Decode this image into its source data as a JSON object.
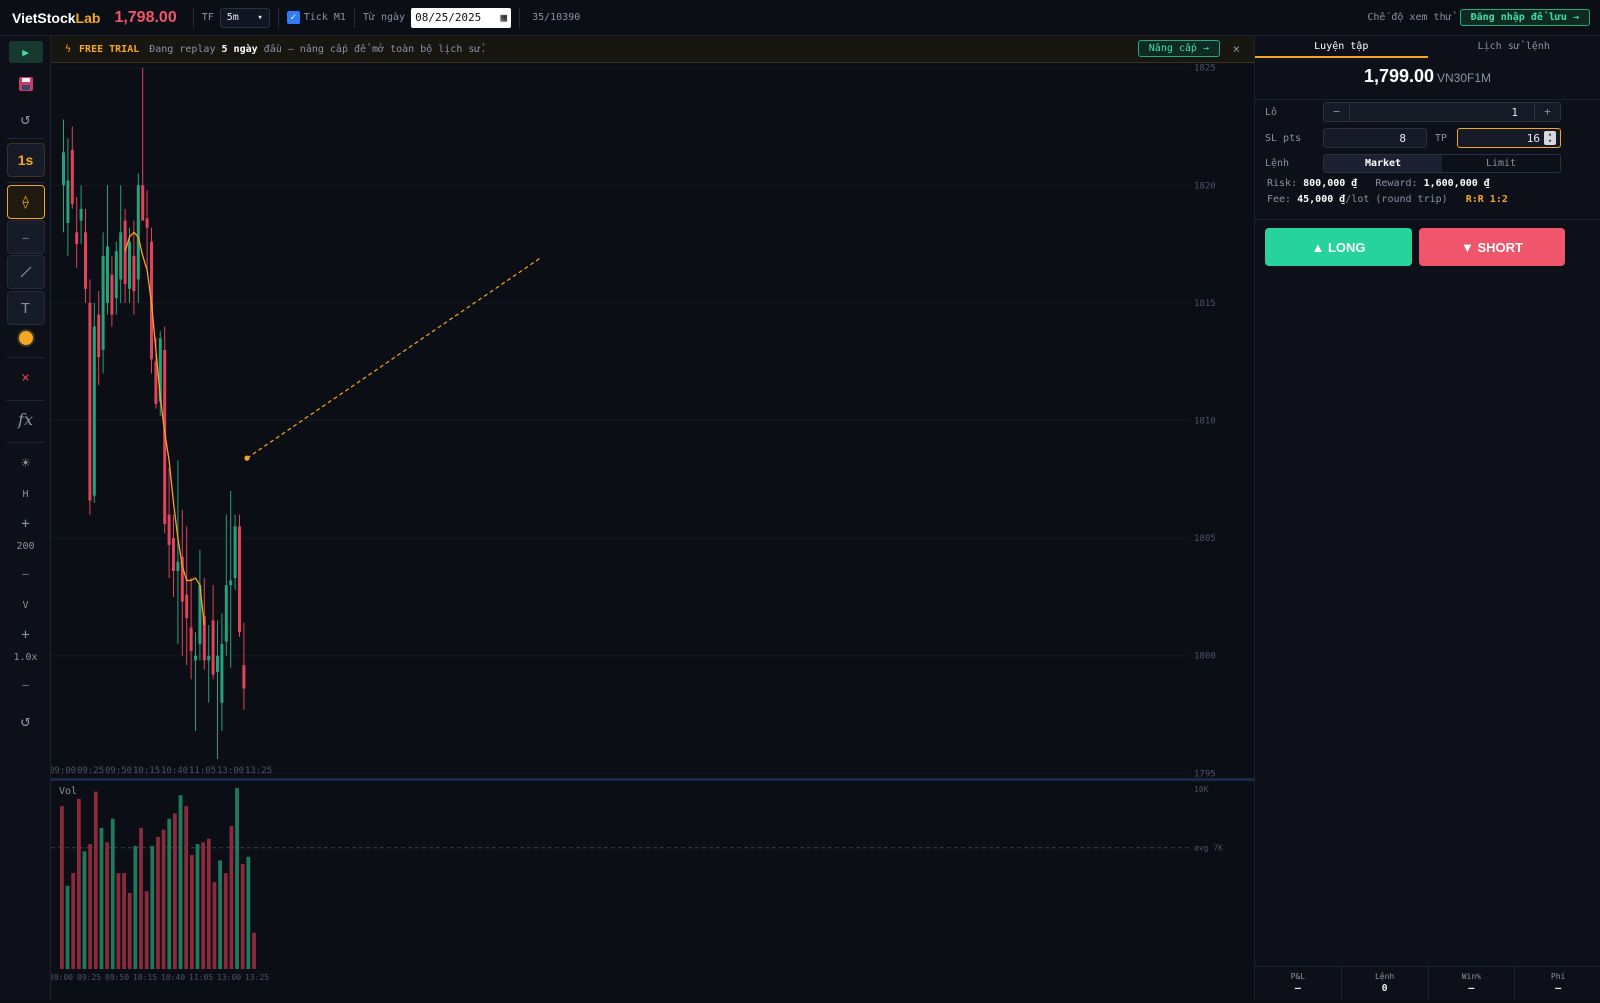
{
  "app": {
    "brand_main": "VietStock",
    "brand_accent": "Lab",
    "last_price": "1,798.00"
  },
  "toolbar": {
    "tf_label": "TF",
    "tf_value": "5m",
    "tick_label": "Tick M1",
    "tick_checked": true,
    "from_label": "Từ ngày",
    "date_value": "08/25/2025",
    "counter": "35/10390",
    "trial_mode": "Chế độ xem thử",
    "login_button": "Đăng nhập để lưu →"
  },
  "sidebar": {
    "play_icon": "play-icon",
    "interval": "1s",
    "h_label": "H",
    "h_value": "200",
    "v_label": "V",
    "v_value": "1.0x",
    "plus": "+",
    "minus": "—",
    "fx": "fx",
    "text_tool": "T",
    "delete": "×",
    "hline": "—",
    "reset": "↺",
    "icons": [
      "play-icon",
      "save-icon",
      "undo-icon",
      "crosshair-icon",
      "horizontal-line-icon",
      "trendline-icon",
      "text-icon",
      "color-icon",
      "delete-icon",
      "fx-icon",
      "brightness-icon",
      "reset-view-icon"
    ]
  },
  "banner": {
    "badge": "FREE TRIAL",
    "text_before": "Đang replay",
    "highlight": "5 ngày",
    "text_after": "đầu — nâng cấp để mở toàn bộ lịch sử.",
    "upgrade_button": "Nâng cấp →",
    "close": "×"
  },
  "chart_data": {
    "type": "candlestick",
    "symbol": "VN30F1M",
    "timeframe": "5m",
    "price_axis_ticks": [
      1825,
      1820,
      1815,
      1810,
      1805,
      1800,
      1795
    ],
    "ylim": [
      1794.8,
      1825.2
    ],
    "time_ticks": [
      "09:00",
      "09:25",
      "09:50",
      "10:15",
      "10:40",
      "11:05",
      "13:00",
      "13:25"
    ],
    "candles": [
      {
        "o": 1820.0,
        "h": 1822.8,
        "l": 1818.0,
        "c": 1821.4
      },
      {
        "o": 1818.4,
        "h": 1822.0,
        "l": 1817.0,
        "c": 1820.2
      },
      {
        "o": 1821.5,
        "h": 1822.5,
        "l": 1819.0,
        "c": 1819.2
      },
      {
        "o": 1818.0,
        "h": 1819.5,
        "l": 1816.5,
        "c": 1817.5
      },
      {
        "o": 1818.5,
        "h": 1820.0,
        "l": 1817.5,
        "c": 1819.0
      },
      {
        "o": 1818.0,
        "h": 1819.0,
        "l": 1815.0,
        "c": 1815.6
      },
      {
        "o": 1815.0,
        "h": 1816.0,
        "l": 1806.0,
        "c": 1806.6
      },
      {
        "o": 1806.8,
        "h": 1815.0,
        "l": 1806.5,
        "c": 1814.0
      },
      {
        "o": 1814.5,
        "h": 1815.5,
        "l": 1811.5,
        "c": 1812.7
      },
      {
        "o": 1813.0,
        "h": 1818.0,
        "l": 1812.0,
        "c": 1817.0
      },
      {
        "o": 1815.0,
        "h": 1820.0,
        "l": 1814.5,
        "c": 1817.4
      },
      {
        "o": 1816.2,
        "h": 1817.0,
        "l": 1814.0,
        "c": 1814.5
      },
      {
        "o": 1815.2,
        "h": 1817.6,
        "l": 1814.5,
        "c": 1817.2
      },
      {
        "o": 1816.0,
        "h": 1820.0,
        "l": 1815.0,
        "c": 1818.0
      },
      {
        "o": 1818.5,
        "h": 1819.0,
        "l": 1815.0,
        "c": 1815.8
      },
      {
        "o": 1815.6,
        "h": 1818.2,
        "l": 1815.0,
        "c": 1817.6
      },
      {
        "o": 1817.0,
        "h": 1818.5,
        "l": 1814.5,
        "c": 1815.5
      },
      {
        "o": 1816.0,
        "h": 1820.5,
        "l": 1815.0,
        "c": 1820.0
      },
      {
        "o": 1820.0,
        "h": 1825.0,
        "l": 1818.5,
        "c": 1818.5
      },
      {
        "o": 1818.6,
        "h": 1819.8,
        "l": 1816.3,
        "c": 1818.2
      },
      {
        "o": 1817.6,
        "h": 1818.2,
        "l": 1812.0,
        "c": 1812.6
      },
      {
        "o": 1812.5,
        "h": 1813.5,
        "l": 1810.5,
        "c": 1810.7
      },
      {
        "o": 1810.8,
        "h": 1813.8,
        "l": 1810.2,
        "c": 1813.5
      },
      {
        "o": 1813.0,
        "h": 1814.0,
        "l": 1805.2,
        "c": 1805.6
      },
      {
        "o": 1806.0,
        "h": 1808.0,
        "l": 1803.3,
        "c": 1804.7
      },
      {
        "o": 1805.0,
        "h": 1806.0,
        "l": 1802.5,
        "c": 1803.6
      },
      {
        "o": 1803.6,
        "h": 1808.3,
        "l": 1800.5,
        "c": 1804.0
      },
      {
        "o": 1804.2,
        "h": 1806.2,
        "l": 1800.0,
        "c": 1802.3
      },
      {
        "o": 1802.6,
        "h": 1805.5,
        "l": 1799.6,
        "c": 1801.6
      },
      {
        "o": 1801.2,
        "h": 1803.3,
        "l": 1799.0,
        "c": 1800.2
      },
      {
        "o": 1799.8,
        "h": 1801.0,
        "l": 1796.8,
        "c": 1800.0
      },
      {
        "o": 1800.5,
        "h": 1804.5,
        "l": 1799.8,
        "c": 1803.0
      },
      {
        "o": 1801.7,
        "h": 1803.3,
        "l": 1799.4,
        "c": 1799.8
      },
      {
        "o": 1799.8,
        "h": 1801.3,
        "l": 1798.0,
        "c": 1800.0
      },
      {
        "o": 1801.5,
        "h": 1803.0,
        "l": 1799.0,
        "c": 1799.2
      },
      {
        "o": 1799.3,
        "h": 1801.5,
        "l": 1795.6,
        "c": 1800.0
      },
      {
        "o": 1798.0,
        "h": 1801.8,
        "l": 1796.8,
        "c": 1800.5
      },
      {
        "o": 1800.6,
        "h": 1806.0,
        "l": 1800.0,
        "c": 1803.0
      },
      {
        "o": 1803.0,
        "h": 1807.0,
        "l": 1799.5,
        "c": 1803.2
      },
      {
        "o": 1803.3,
        "h": 1806.0,
        "l": 1802.8,
        "c": 1805.5
      },
      {
        "o": 1805.5,
        "h": 1806.0,
        "l": 1800.8,
        "c": 1801.0
      },
      {
        "o": 1799.6,
        "h": 1801.4,
        "l": 1797.7,
        "c": 1798.6
      }
    ],
    "ma_line": [
      1817.2,
      1817.8,
      1818.0,
      1817.8,
      1817.0,
      1816.4,
      1815.0,
      1813.0,
      1811.0,
      1809.5,
      1808.3,
      1806.5,
      1805.0,
      1803.8,
      1803.2,
      1803.2,
      1803.3,
      1803.0,
      1801.3
    ],
    "ma_start_index": 14,
    "trendline": {
      "from": [
        28,
        1808.4
      ],
      "to": [
        173,
        1816.9
      ]
    },
    "volume": {
      "label": "Vol",
      "axis_max_label": "10K",
      "avg_label": "avg 7K",
      "ylim": [
        0,
        10000
      ],
      "avg": 6700,
      "values": [
        9000,
        4600,
        5300,
        9400,
        6500,
        6900,
        9800,
        7800,
        7000,
        8300,
        5300,
        5300,
        4200,
        6800,
        7800,
        4300,
        6800,
        7300,
        7700,
        8300,
        8600,
        9600,
        9000,
        6300,
        6900,
        7000,
        7200,
        4800,
        6000,
        5300,
        7900,
        10000,
        5800,
        6200,
        2000
      ],
      "up": [
        false,
        true,
        false,
        false,
        true,
        false,
        false,
        true,
        false,
        true,
        false,
        false,
        false,
        true,
        false,
        false,
        true,
        false,
        false,
        true,
        false,
        true,
        false,
        false,
        true,
        false,
        false,
        false,
        true,
        false,
        false,
        true,
        false,
        true,
        false
      ]
    },
    "colors": {
      "up": "#26a17b",
      "down": "#e0435a",
      "ma": "#f5a623",
      "grid": "#141925",
      "axis_text": "#4c5468"
    }
  },
  "order_panel": {
    "tabs": [
      "Luyện tập",
      "Lịch sử lệnh"
    ],
    "price": "1,799.00",
    "symbol": "VN30F1M",
    "lot_label": "Lô",
    "lot_minus": "−",
    "lot_value": "1",
    "lot_plus": "+",
    "sl_label": "SL pts",
    "sl_value": "8",
    "tp_label": "TP",
    "tp_value": "16",
    "order_label": "Lệnh",
    "order_types": [
      "Market",
      "Limit"
    ],
    "risk_label": "Risk:",
    "risk_value": "800,000 ₫",
    "reward_label": "Reward:",
    "reward_value": "1,600,000 ₫",
    "fee_label": "Fee:",
    "fee_value": "45,000 ₫",
    "fee_suffix": "/lot (round trip)",
    "rr": "R:R 1:2",
    "long_button": "▲ LONG",
    "short_button": "▼ SHORT"
  },
  "stats": [
    {
      "label": "P&L",
      "value": "—"
    },
    {
      "label": "Lệnh",
      "value": "0"
    },
    {
      "label": "Win%",
      "value": "—"
    },
    {
      "label": "Phí",
      "value": "—"
    }
  ]
}
